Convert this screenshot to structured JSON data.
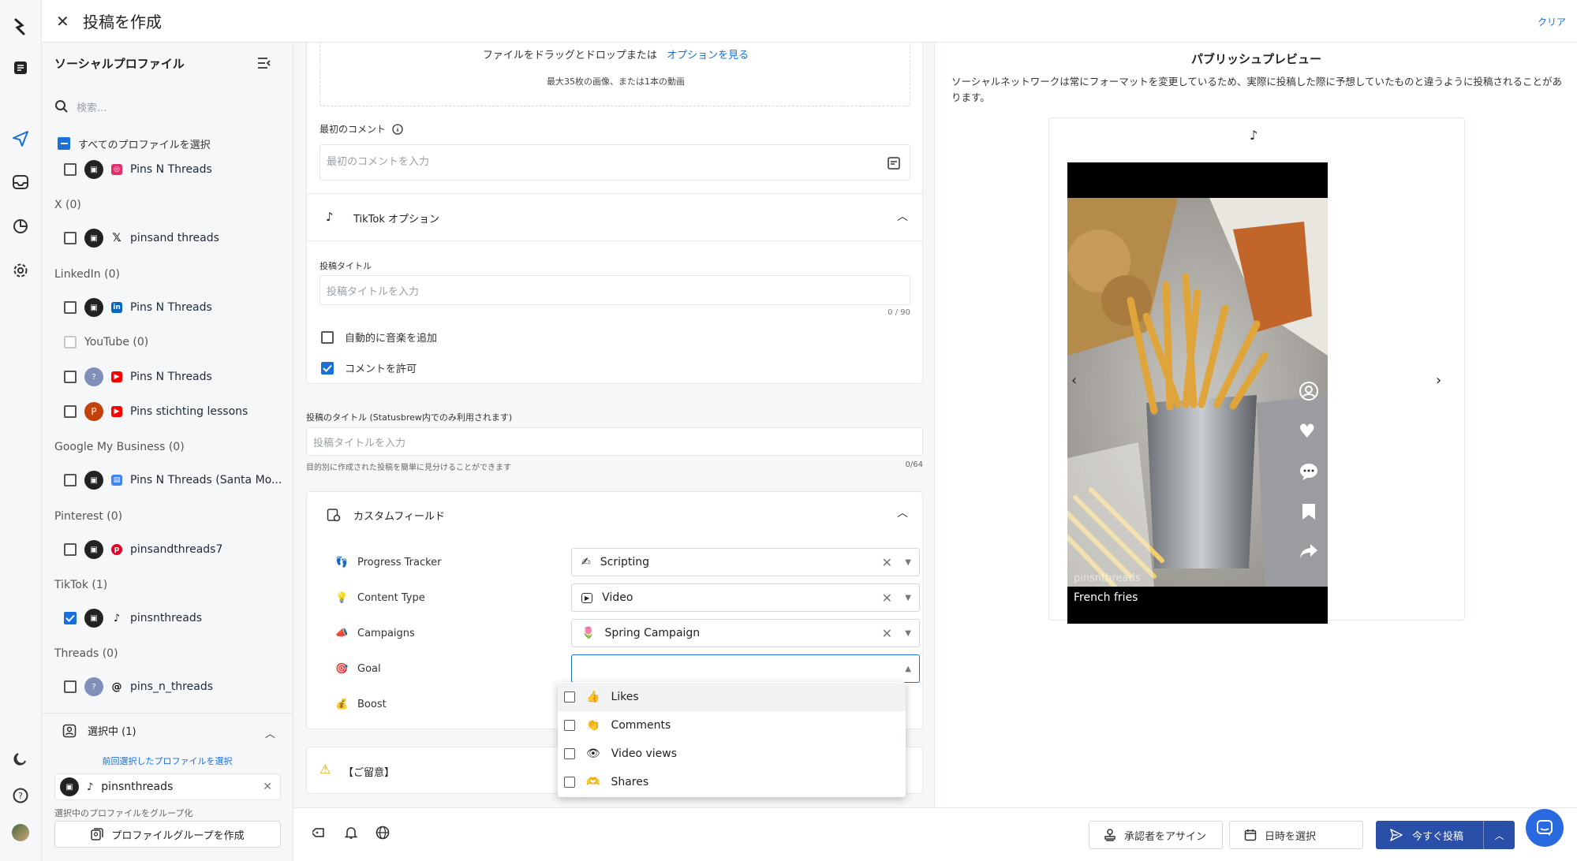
{
  "header": {
    "title": "投稿を作成",
    "clear": "クリア"
  },
  "sidebar": {
    "title": "ソーシャルプロファイル",
    "search_placeholder": "検索...",
    "select_all": "すべてのプロファイルを選択",
    "groups": [
      {
        "label": "",
        "items": [
          {
            "name": "Pins N Threads",
            "network": "instagram",
            "checked": false
          }
        ]
      },
      {
        "label": "X (0)",
        "items": [
          {
            "name": "pinsand threads",
            "network": "x",
            "checked": false
          }
        ]
      },
      {
        "label": "LinkedIn (0)",
        "items": [
          {
            "name": "Pins N Threads",
            "network": "linkedin",
            "checked": false
          }
        ]
      },
      {
        "label": "YouTube (0)",
        "items": [
          {
            "name": "Pins N Threads",
            "network": "youtube",
            "checked": false
          },
          {
            "name": "Pins stichting lessons",
            "network": "youtube",
            "checked": false
          }
        ]
      },
      {
        "label": "Google My Business (0)",
        "items": [
          {
            "name": "Pins N Threads (Santa Mo...",
            "network": "gmb",
            "checked": false
          }
        ]
      },
      {
        "label": "Pinterest (0)",
        "items": [
          {
            "name": "pinsandthreads7",
            "network": "pinterest",
            "checked": false
          }
        ]
      },
      {
        "label": "TikTok (1)",
        "items": [
          {
            "name": "pinsnthreads",
            "network": "tiktok",
            "checked": true
          }
        ]
      },
      {
        "label": "Threads (0)",
        "items": [
          {
            "name": "pins_n_threads",
            "network": "threads",
            "checked": false
          }
        ]
      }
    ],
    "selected_label": "選択中 (1)",
    "prev_selected_link": "前回選択したプロファイルを選択",
    "selected_chip": "pinsnthreads",
    "group_hint": "選択中のプロファイルをグループ化",
    "create_group_button": "プロファイルグループを作成"
  },
  "form": {
    "drop_text": "ファイルをドラッグとドロップまたは",
    "drop_link": "オプションを見る",
    "drop_limit": "最大35枚の画像、または1本の動画",
    "first_comment_label": "最初のコメント",
    "first_comment_placeholder": "最初のコメントを入力",
    "tiktok_options_title": "TikTok オプション",
    "post_title_label": "投稿タイトル",
    "post_title_placeholder": "投稿タイトルを入力",
    "post_title_counter": "0 / 90",
    "auto_music_label": "自動的に音楽を追加",
    "allow_comments_label": "コメントを許可",
    "internal_title_label": "投稿のタイトル (Statusbrew内でのみ利用されます)",
    "internal_title_placeholder": "投稿タイトルを入力",
    "internal_title_hint": "目的別に作成された投稿を簡単に見分けることができます",
    "internal_title_counter": "0/64",
    "custom_fields_title": "カスタムフィールド",
    "custom_fields": [
      {
        "label": "Progress Tracker",
        "icon": "👣",
        "value": "Scripting",
        "value_icon": "✍"
      },
      {
        "label": "Content Type",
        "icon": "💡",
        "value": "Video",
        "value_icon": "▶"
      },
      {
        "label": "Campaigns",
        "icon": "📣",
        "value": "Spring Campaign",
        "value_icon": "🌷"
      },
      {
        "label": "Goal",
        "icon": "🎯",
        "value": "",
        "value_icon": ""
      },
      {
        "label": "Boost",
        "icon": "💰",
        "value": "",
        "value_icon": ""
      }
    ],
    "notice_title": "【ご留意】"
  },
  "goal_options": [
    {
      "label": "Likes",
      "icon": "👍"
    },
    {
      "label": "Comments",
      "icon": "👏"
    },
    {
      "label": "Video views",
      "icon": "👁"
    },
    {
      "label": "Shares",
      "icon": "🫶"
    }
  ],
  "preview": {
    "title": "パブリッシュプレビュー",
    "notice": "ソーシャルネットワークは常にフォーマットを変更しているため、実際に投稿した際に予想していたものと違うように投稿されることがあります。",
    "username": "pinsnthreads",
    "caption": "French fries"
  },
  "bottom": {
    "assign_approver": "承認者をアサイン",
    "pick_datetime": "日時を選択",
    "post_now": "今すぐ投稿"
  },
  "colors": {
    "accent": "#1b6fd9",
    "primary_button": "#2a4fa8",
    "link": "#1b6fd9"
  }
}
